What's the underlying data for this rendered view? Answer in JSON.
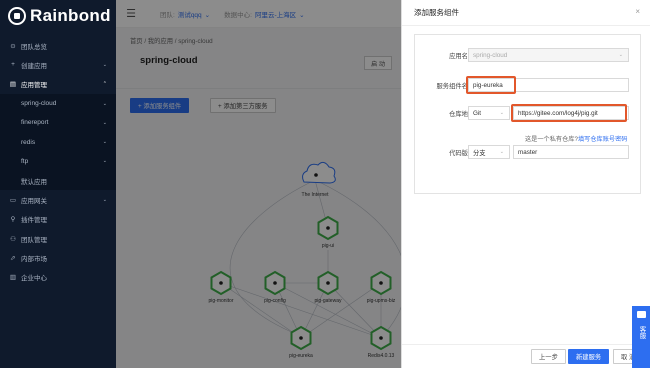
{
  "sidebar": {
    "logo_text": "Rainbond",
    "items": [
      {
        "label": "团队总览",
        "icon": "⊙",
        "arrow": ""
      },
      {
        "label": "创建应用",
        "icon": "+",
        "arrow": "⌄"
      },
      {
        "label": "应用管理",
        "icon": "▤",
        "arrow": "⌃"
      },
      {
        "label": "spring-cloud",
        "icon": "",
        "arrow": "⌄"
      },
      {
        "label": "finereport",
        "icon": "",
        "arrow": "⌄"
      },
      {
        "label": "redis",
        "icon": "",
        "arrow": "⌄"
      },
      {
        "label": "ftp",
        "icon": "",
        "arrow": "⌄"
      },
      {
        "label": "默认应用",
        "icon": "",
        "arrow": ""
      },
      {
        "label": "应用网关",
        "icon": "▭",
        "arrow": "⌄"
      },
      {
        "label": "插件管理",
        "icon": "⚲",
        "arrow": ""
      },
      {
        "label": "团队管理",
        "icon": "⚇",
        "arrow": ""
      },
      {
        "label": "内部市场",
        "icon": "⬀",
        "arrow": ""
      },
      {
        "label": "企业中心",
        "icon": "▥",
        "arrow": ""
      }
    ]
  },
  "topbar": {
    "menu_icon": "☰",
    "team_label": "团队:",
    "team_value": "测试qqq",
    "dc_label": "数据中心:",
    "dc_value": "阿里云-上海区"
  },
  "main": {
    "breadcrumb": "首页 / 我的应用 / spring-cloud",
    "title": "spring-cloud",
    "start_label": "启 动",
    "add_component_label": "+ 添加服务组件",
    "add_third_label": "+ 添加第三方服务"
  },
  "topology": {
    "internet_label": "The Internet",
    "nodes": [
      {
        "id": "pig-ui",
        "label": "pig-ui"
      },
      {
        "id": "pig-monitor",
        "label": "pig-monitor"
      },
      {
        "id": "pig-config",
        "label": "pig-config"
      },
      {
        "id": "pig-gateway",
        "label": "pig-gateway"
      },
      {
        "id": "pig-upms-biz",
        "label": "pig-upms-biz"
      },
      {
        "id": "pig-eureka",
        "label": "pig-eureka"
      },
      {
        "id": "redis",
        "label": "Redis4.0.13"
      }
    ],
    "node_color": "#3fae49"
  },
  "panel": {
    "title": "添加服务组件",
    "close_icon": "×",
    "app_name_label": "应用名称:",
    "app_name_value": "spring-cloud",
    "component_name_label": "服务组件名称:",
    "component_name_value": "pig-eureka",
    "repo_label": "仓库地址:",
    "repo_type": "Git",
    "repo_url": "https://gitee.com/log4j/pig.git",
    "private_hint": "这是一个私有仓库?",
    "private_link": "填写仓库账号密码",
    "version_label": "代码版本:",
    "version_type": "分支",
    "version_value": "master",
    "prev_label": "上一步",
    "create_label": "新建服务",
    "cancel_label": "取 消",
    "highlight_color": "#e2572b"
  },
  "chat": {
    "label": "客服"
  }
}
